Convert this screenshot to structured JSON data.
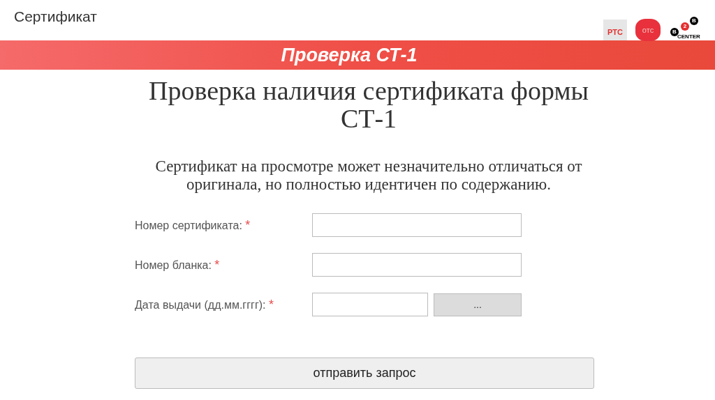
{
  "slide_title": "Сертификат",
  "logos": [
    {
      "kind": "rts",
      "text": "РТС"
    },
    {
      "kind": "ots",
      "text": "отс"
    },
    {
      "kind": "b2b",
      "letters": [
        "B",
        "2",
        "B"
      ],
      "text": "CENTER"
    }
  ],
  "banner": "Проверка СТ-1",
  "heading": "Проверка наличия сертификата формы СТ-1",
  "note": "Сертификат на просмотре может незначительно отличаться от оригинала, но полностью идентичен по содержанию.",
  "fields": [
    {
      "label": "Номер сертификата:",
      "required": "*",
      "kind": "text"
    },
    {
      "label": "Номер бланка:",
      "required": "*",
      "kind": "text"
    },
    {
      "label": "Дата выдачи (дд.мм.гггг):",
      "required": "*",
      "kind": "date",
      "button": "..."
    }
  ],
  "submit": "отправить запрос"
}
